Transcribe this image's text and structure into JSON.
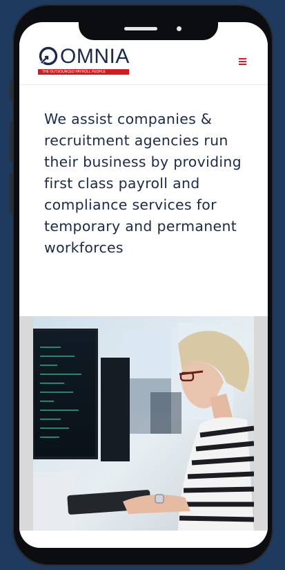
{
  "header": {
    "brand": "OMNIA",
    "tagline": "THE OUTSOURCED PAYROLL PEOPLE",
    "menu_icon": "hamburger-menu-icon"
  },
  "hero": {
    "headline": "We assist companies & recruitment agencies run their business by providing first class payroll and compliance services for temporary and permanent workforces"
  },
  "colors": {
    "brand_navy": "#1b2a4a",
    "brand_red": "#d71920",
    "page_background": "#1f3a5f",
    "device_frame": "#0c0d10"
  }
}
